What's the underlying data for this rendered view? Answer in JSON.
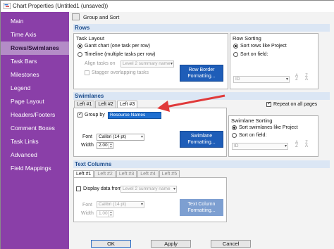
{
  "window": {
    "title": "Chart Properties (Untitled1 (unsaved))",
    "toolbar_label": "Group and Sort"
  },
  "sidebar": {
    "items": [
      {
        "label": "Main",
        "active": false
      },
      {
        "label": "Time Axis",
        "active": false
      },
      {
        "label": "Rows/Swimlanes",
        "active": true
      },
      {
        "label": "Task Bars",
        "active": false
      },
      {
        "label": "Milestones",
        "active": false
      },
      {
        "label": "Legend",
        "active": false
      },
      {
        "label": "Page Layout",
        "active": false
      },
      {
        "label": "Headers/Footers",
        "active": false
      },
      {
        "label": "Comment Boxes",
        "active": false
      },
      {
        "label": "Task Links",
        "active": false
      },
      {
        "label": "Advanced",
        "active": false
      },
      {
        "label": "Field Mappings",
        "active": false
      }
    ]
  },
  "rows": {
    "header": "Rows",
    "task_layout": {
      "legend": "Task Layout",
      "option1": "Gantt chart (one task per row)",
      "option2": "Timeline (multiple tasks per row)",
      "align_label": "Align tasks on",
      "align_value": "Level 2 summary name",
      "stagger_label": "Stagger overlapping tasks"
    },
    "border_button": {
      "line1": "Row Border",
      "line2": "Formatting..."
    },
    "row_sorting": {
      "legend": "Row Sorting",
      "option1": "Sort rows like Project",
      "option2": "Sort on field:",
      "field_value": "ID"
    }
  },
  "swimlanes": {
    "header": "Swimlanes",
    "tabs": [
      "Left #1",
      "Left #2",
      "Left #3"
    ],
    "repeat_label": "Repeat on all pages",
    "group_by_label": "Group by",
    "group_by_value": "Resource Names",
    "font_label": "Font",
    "font_value": "Calibri (14 pt)",
    "width_label": "Width",
    "width_value": "2.00",
    "format_button": {
      "line1": "Swimlane",
      "line2": "Formatting..."
    },
    "sorting": {
      "legend": "Swimlane Sorting",
      "option1": "Sort swimlanes like Project",
      "option2": "Sort on field:",
      "field_value": "ID"
    }
  },
  "text_columns": {
    "header": "Text Columns",
    "tabs": [
      "Left #1",
      "Left #2",
      "Left #3",
      "Left #4",
      "Left #5"
    ],
    "display_label": "Display data from",
    "display_value": "Level 2 summary name",
    "font_label": "Font",
    "font_value": "Calibri (14 pt)",
    "width_label": "Width",
    "width_value": "1.00",
    "format_button": {
      "line1": "Text Column",
      "line2": "Formatting..."
    }
  },
  "footer": {
    "ok": "OK",
    "apply": "Apply",
    "cancel": "Cancel"
  },
  "colors": {
    "sidebar": "#8a3fa8",
    "sidebar_active": "#b48cc7",
    "section_header": "#dbe6f4",
    "button_blue": "#1e5db8",
    "annotation_arrow": "#e03a3a"
  }
}
